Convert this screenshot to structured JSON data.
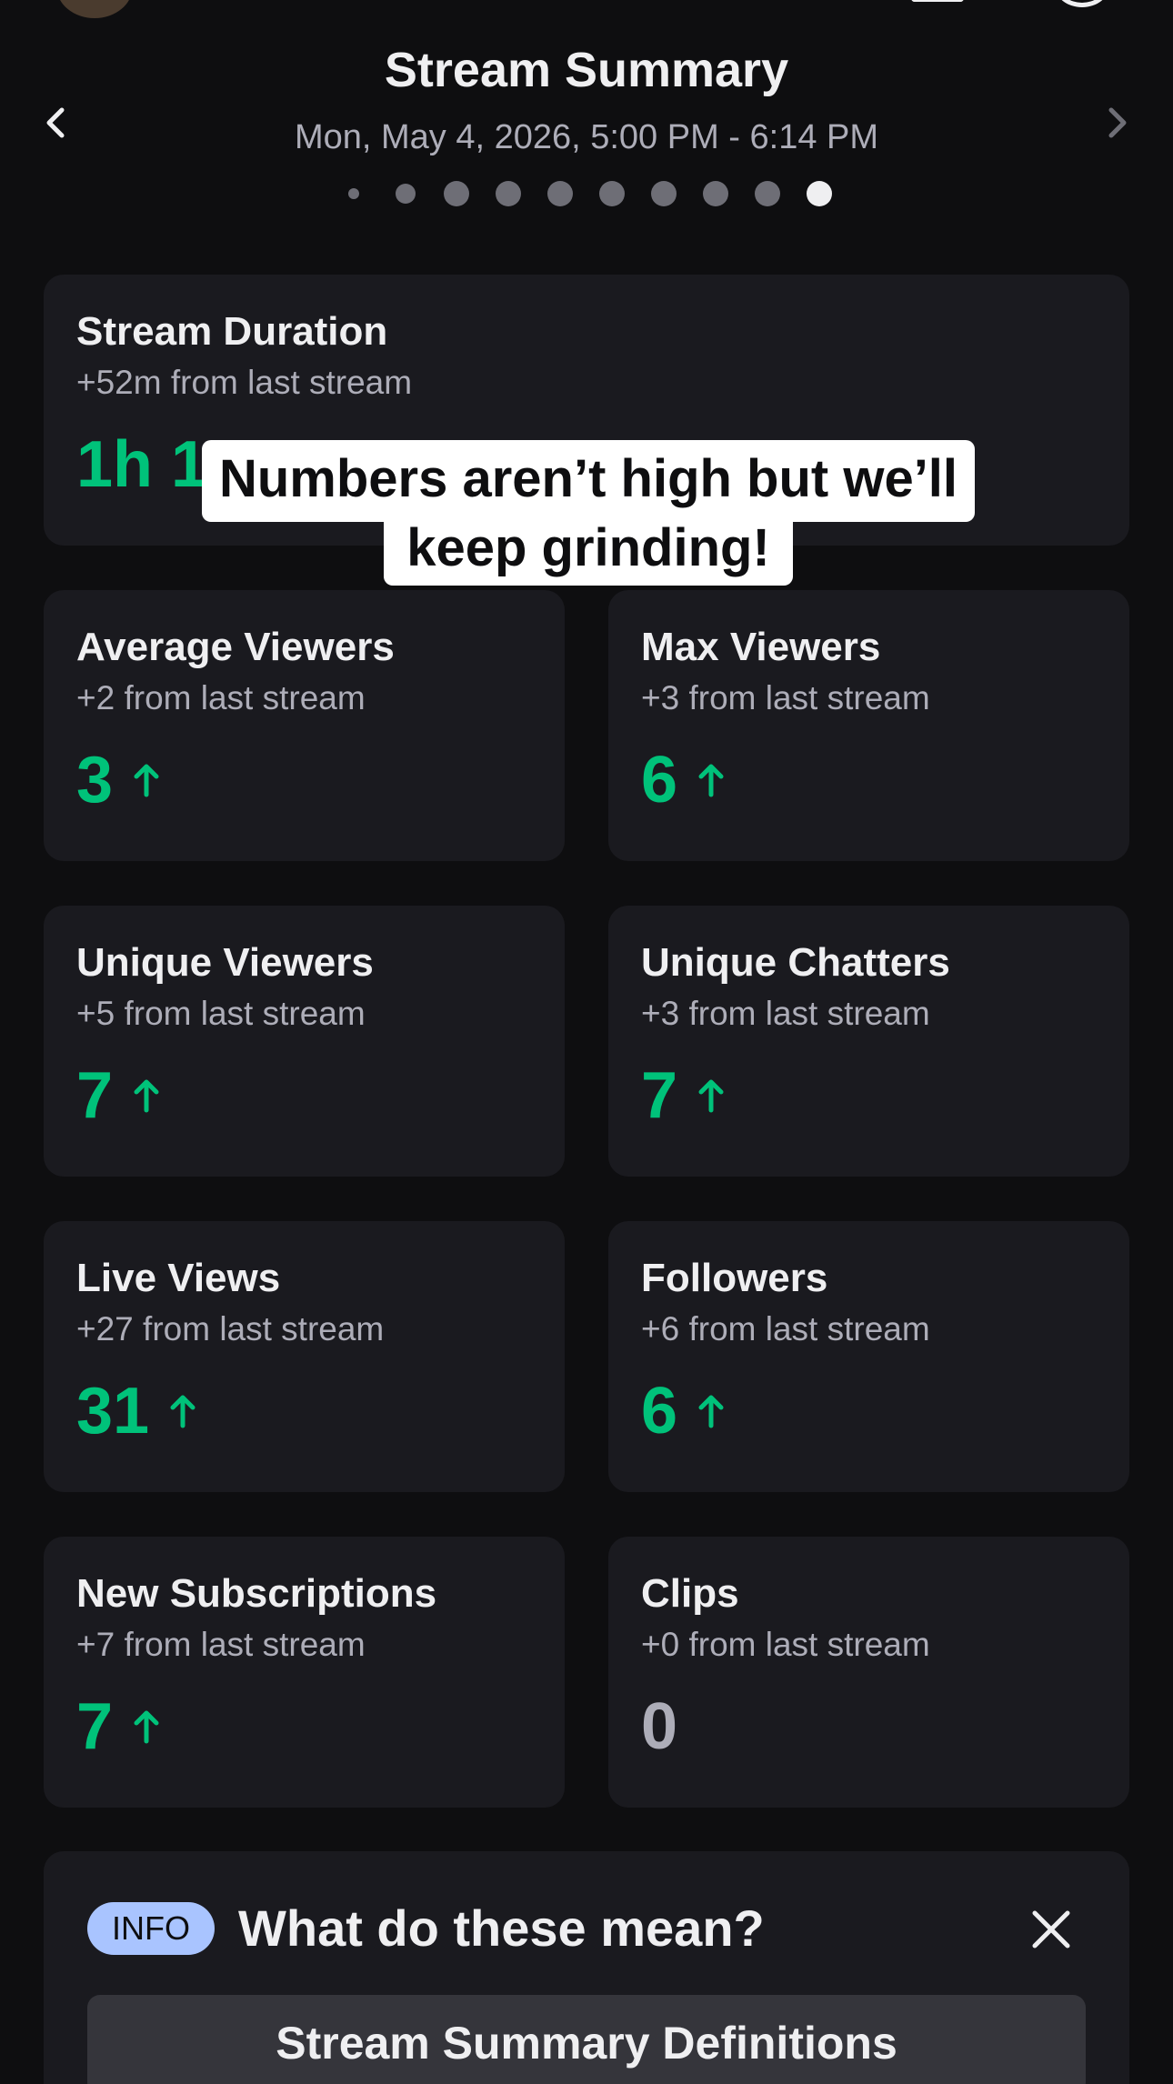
{
  "header": {
    "title": "Stream Summary",
    "date_range": "Mon, May 4, 2026, 5:00 PM - 6:14 PM",
    "page_count": 10,
    "active_page": 10
  },
  "stats": {
    "duration": {
      "title": "Stream Duration",
      "delta": "+52m from last stream",
      "value": "1h 14m"
    },
    "average_viewers": {
      "title": "Average Viewers",
      "delta": "+2 from last stream",
      "value": "3",
      "trend": "up"
    },
    "max_viewers": {
      "title": "Max Viewers",
      "delta": "+3 from last stream",
      "value": "6",
      "trend": "up"
    },
    "unique_viewers": {
      "title": "Unique Viewers",
      "delta": "+5 from last stream",
      "value": "7",
      "trend": "up"
    },
    "unique_chatters": {
      "title": "Unique Chatters",
      "delta": "+3 from last stream",
      "value": "7",
      "trend": "up"
    },
    "live_views": {
      "title": "Live Views",
      "delta": "+27 from last stream",
      "value": "31",
      "trend": "up"
    },
    "followers": {
      "title": "Followers",
      "delta": "+6 from last stream",
      "value": "6",
      "trend": "up"
    },
    "new_subscriptions": {
      "title": "New Subscriptions",
      "delta": "+7 from last stream",
      "value": "7",
      "trend": "up"
    },
    "clips": {
      "title": "Clips",
      "delta": "+0 from last stream",
      "value": "0",
      "trend": "none"
    }
  },
  "caption": {
    "line1": "Numbers aren’t high but we’ll",
    "line2": "keep grinding!"
  },
  "info": {
    "badge": "INFO",
    "heading": "What do these mean?",
    "button_label": "Stream Summary Definitions"
  },
  "colors": {
    "background": "#0e0e10",
    "card": "#1a1a1f",
    "positive": "#00c27a",
    "info_badge": "#a9c4ff"
  }
}
